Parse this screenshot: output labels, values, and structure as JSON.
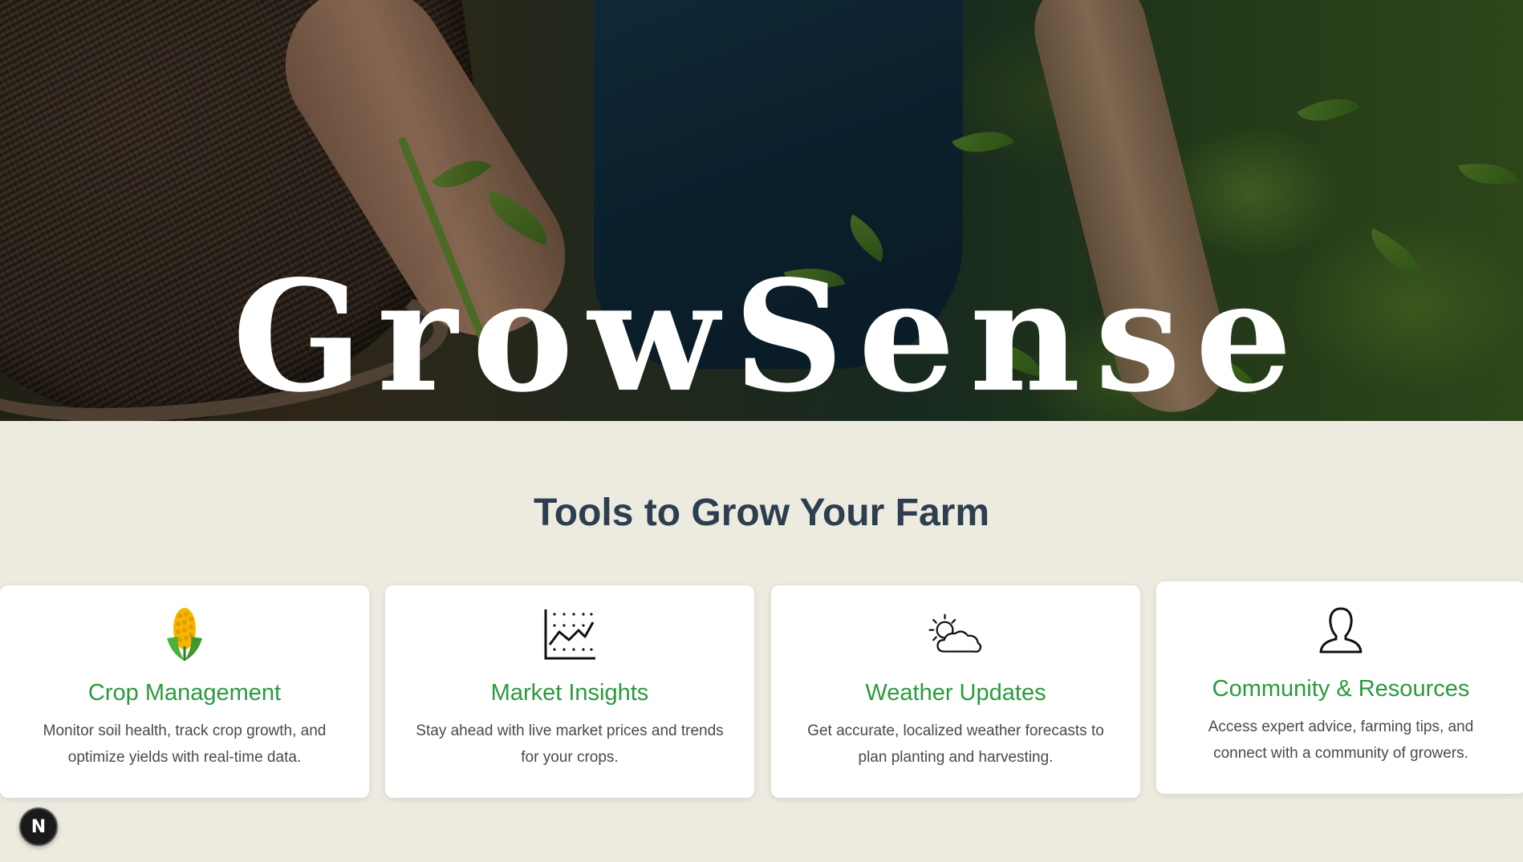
{
  "hero": {
    "brand": "GrowSense"
  },
  "features": {
    "heading": "Tools to Grow Your Farm",
    "cards": [
      {
        "icon": "corn-icon",
        "title": "Crop Management",
        "description": "Monitor soil health, track crop growth, and optimize yields with real-time data."
      },
      {
        "icon": "chart-icon",
        "title": "Market Insights",
        "description": "Stay ahead with live market prices and trends for your crops."
      },
      {
        "icon": "sun-cloud-icon",
        "title": "Weather Updates",
        "description": "Get accurate, localized weather forecasts to plan planting and harvesting."
      },
      {
        "icon": "person-icon",
        "title": "Community & Resources",
        "description": "Access expert advice, farming tips, and connect with a community of growers."
      }
    ]
  },
  "dev_badge": {
    "label": "N"
  },
  "colors": {
    "background": "#edeadf",
    "heading": "#2c3e50",
    "accent_green": "#2a9a3c",
    "body_text": "#4a4a4a"
  }
}
